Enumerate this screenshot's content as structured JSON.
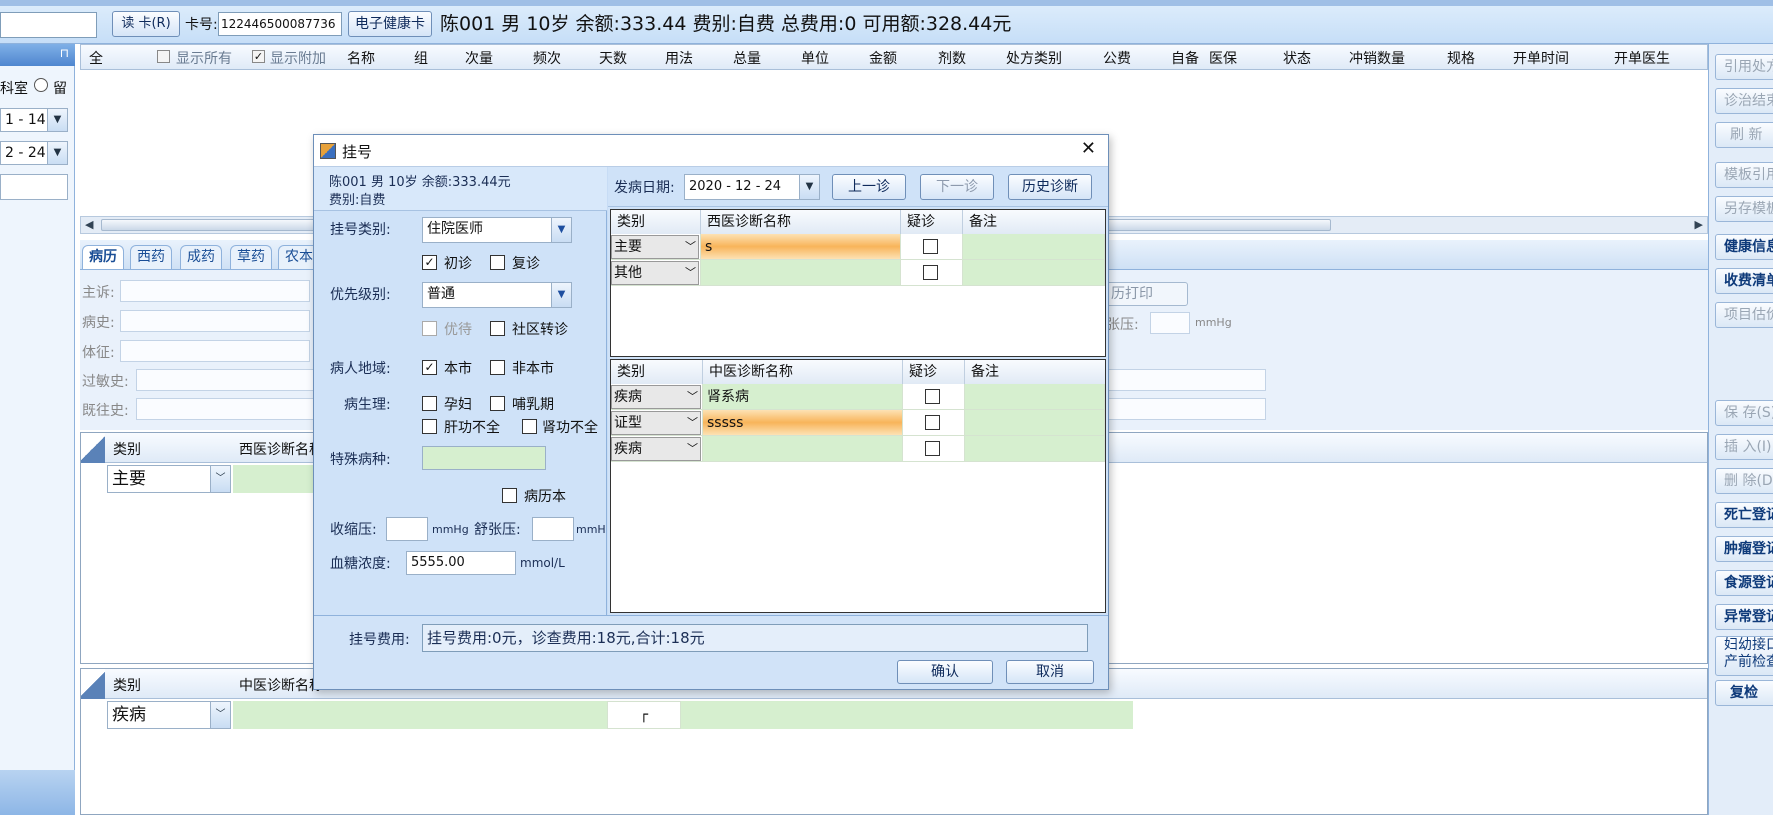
{
  "topbar": {
    "read_card_label": "读 卡(R)",
    "card_no_label": "卡号:",
    "card_no_value": "122446500087736",
    "ehealth_label": "电子健康卡",
    "patient_summary": "陈001 男 10岁 余额:333.44 费别:自费 总费用:0 可用额:328.44元"
  },
  "left_panel": {
    "dept_label": "科室",
    "stay_label": "留",
    "date1": "1 - 14",
    "date2": "2 - 24"
  },
  "grid": {
    "all_label": "全",
    "show_all_label": "显示所有",
    "show_extra_label": "显示附加",
    "columns": [
      "名称",
      "组",
      "次量",
      "频次",
      "天数",
      "用法",
      "总量",
      "单位",
      "金额",
      "剂数",
      "处方类别",
      "公费",
      "自备",
      "医保",
      "状态",
      "冲销数量",
      "规格",
      "开单时间",
      "开单医生"
    ]
  },
  "tabs": [
    "病历",
    "西药",
    "成药",
    "草药",
    "农本"
  ],
  "form": {
    "labels": [
      "主诉:",
      "病史:",
      "体征:",
      "过敏史:",
      "既往史:"
    ],
    "print_label": "历打印",
    "diastolic_label": "张压:",
    "mmhg": "mmHg"
  },
  "bottom_grids": {
    "west": {
      "col_type": "类别",
      "col_name": "西医诊断名称",
      "row_type": "主要"
    },
    "tcm": {
      "col_type": "类别",
      "col_name": "中医诊断名称",
      "row_type": "疾病"
    }
  },
  "right_panel": {
    "buttons": [
      "引用处方",
      "诊治结束",
      "刷 新",
      "模板引用",
      "另存模板",
      "健康信息",
      "收费清单",
      "项目估价",
      "保 存(S)",
      "插 入(I)",
      "删 除(D)",
      "死亡登记",
      "肿瘤登记",
      "食源登记",
      "异常登记",
      "妇幼接口 产前检查",
      "复检"
    ]
  },
  "dialog": {
    "title": "挂号",
    "close": "✕",
    "patient_line1": "陈001 男 10岁 余额:333.44元",
    "patient_line2": "费别:自费",
    "reg_type_label": "挂号类别:",
    "reg_type_value": "住院医师",
    "first_visit": "初诊",
    "re_visit": "复诊",
    "priority_label": "优先级别:",
    "priority_value": "普通",
    "priority_care": "优待",
    "community": "社区转诊",
    "region_label": "病人地域:",
    "local": "本市",
    "nonlocal": "非本市",
    "physio_label": "病生理:",
    "pregnant": "孕妇",
    "lactation": "哺乳期",
    "liver": "肝功不全",
    "kidney": "肾功不全",
    "special_label": "特殊病种:",
    "record_book": "病历本",
    "systolic_label": "收缩压:",
    "diastolic_label": "舒张压:",
    "mmhg": "mmHg",
    "glucose_label": "血糖浓度:",
    "glucose_value": "5555.00",
    "glucose_unit": "mmol/L",
    "onset_label": "发病日期:",
    "onset_value": "2020 - 12 - 24",
    "prev_btn": "上一诊",
    "next_btn": "下一诊",
    "history_btn": "历史诊断",
    "west_table": {
      "headers": [
        "类别",
        "西医诊断名称",
        "疑诊",
        "备注"
      ],
      "rows": [
        [
          "主要",
          "s"
        ],
        [
          "其他",
          ""
        ]
      ]
    },
    "tcm_table": {
      "headers": [
        "类别",
        "中医诊断名称",
        "疑诊",
        "备注"
      ],
      "rows": [
        [
          "疾病",
          "肾系病"
        ],
        [
          "证型",
          "sssss"
        ],
        [
          "疾病",
          ""
        ]
      ]
    },
    "fee_label": "挂号费用:",
    "fee_value": "挂号费用:0元，诊查费用:18元,合计:18元",
    "ok_btn": "确认",
    "cancel_btn": "取消"
  }
}
